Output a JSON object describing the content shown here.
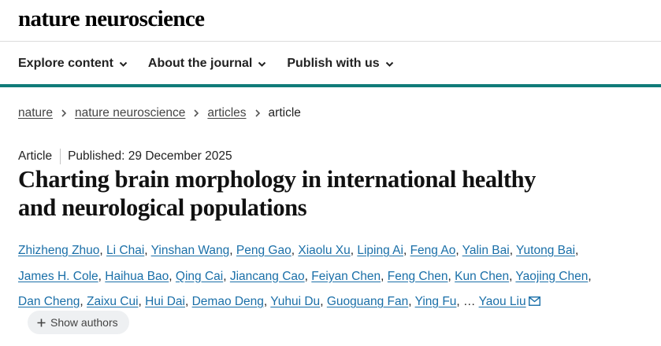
{
  "site": {
    "logo_text": "nature neuroscience"
  },
  "nav": {
    "items": [
      {
        "label": "Explore content"
      },
      {
        "label": "About the journal"
      },
      {
        "label": "Publish with us"
      }
    ]
  },
  "colors": {
    "accent": "#0f7b78",
    "link": "#1a6fa8"
  },
  "breadcrumb": {
    "items": [
      "nature",
      "nature neuroscience",
      "articles"
    ],
    "current": "article"
  },
  "article": {
    "type": "Article",
    "published": "Published: 29 December 2025",
    "title_line1": "Charting brain morphology in international healthy",
    "title_line2": "and neurological populations"
  },
  "authors": [
    "Zhizheng Zhuo",
    "Li Chai",
    "Yinshan Wang",
    "Peng Gao",
    "Xiaolu Xu",
    "Liping Ai",
    "Feng Ao",
    "Yalin Bai",
    "Yutong Bai",
    "James H. Cole",
    "Haihua Bao",
    "Qing Cai",
    "Jiancang Cao",
    "Feiyan Chen",
    "Feng Chen",
    "Kun Chen",
    "Yaojing Chen",
    "Dan Cheng",
    "Zaixu Cui",
    "Hui Dai",
    "Demao Deng",
    "Yuhui Du",
    "Guoguang Fan",
    "Ying Fu"
  ],
  "ellipsis": "…",
  "last_author": "Yaou Liu",
  "show_authors_label": "Show authors"
}
